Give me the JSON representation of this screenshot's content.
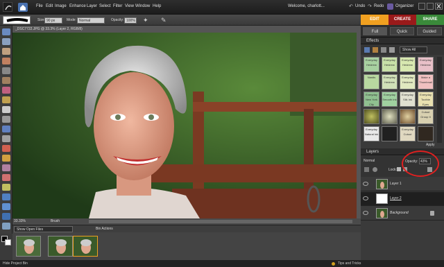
{
  "menu": {
    "items": [
      "File",
      "Edit",
      "Image",
      "Enhance",
      "Layer",
      "Select",
      "Filter",
      "View",
      "Window",
      "Help"
    ],
    "welcome": "Welcome, charlott...",
    "undo": "Undo",
    "redo": "Redo",
    "organizer": "Organizer"
  },
  "options": {
    "size_label": "Size:",
    "size_value": "90 px",
    "mode_label": "Mode:",
    "mode_value": "Normal",
    "opacity_label": "Opacity:",
    "opacity_value": "100%"
  },
  "tabs": {
    "edit": "EDIT",
    "create": "CREATE",
    "share": "SHARE"
  },
  "modes": {
    "full": "Full",
    "quick": "Quick",
    "guided": "Guided"
  },
  "document": {
    "title": "_DSC7722.JPG @ 33.3% (Layer 2, RGB/8)",
    "zoom": "33.33%",
    "status_tool": "Brush"
  },
  "bin": {
    "dropdown": "Show Open Files",
    "actions": "Bin Actions"
  },
  "bottom": {
    "hide_bin": "Hide Project Bin",
    "tips": "Tips and Tricks"
  },
  "effects": {
    "title": "Effects",
    "show_all": "Show All",
    "apply": "Apply",
    "tiles": [
      "Everyday Heidrew",
      "Everyday Heidrew",
      "Everyday Heidrew",
      "Everyday Heidrew",
      "Nardis",
      "Everyday Heidrew",
      "Everyday Heidrew",
      "Make a Thumbnail",
      "Everyday New York City",
      "Everyday Smooth Ink",
      "Everyday Silk Ink",
      "Everyday Toothie Eyes",
      "",
      "",
      "",
      "Cutout Group It",
      "Everyday Natural Ink",
      "",
      "Everyday Cutout",
      "",
      "",
      "",
      "",
      ""
    ]
  },
  "layers": {
    "title": "Layers",
    "blend": "Normal",
    "opacity_label": "Opacity:",
    "opacity_value": "43%",
    "lock_label": "Lock:",
    "items": [
      "Layer 1",
      "Layer 2",
      "Background"
    ]
  },
  "colors": {
    "accent_edit": "#f0a020",
    "accent_create": "#9a1a1a",
    "accent_share": "#3a8a3a",
    "annotation": "#e02020"
  }
}
